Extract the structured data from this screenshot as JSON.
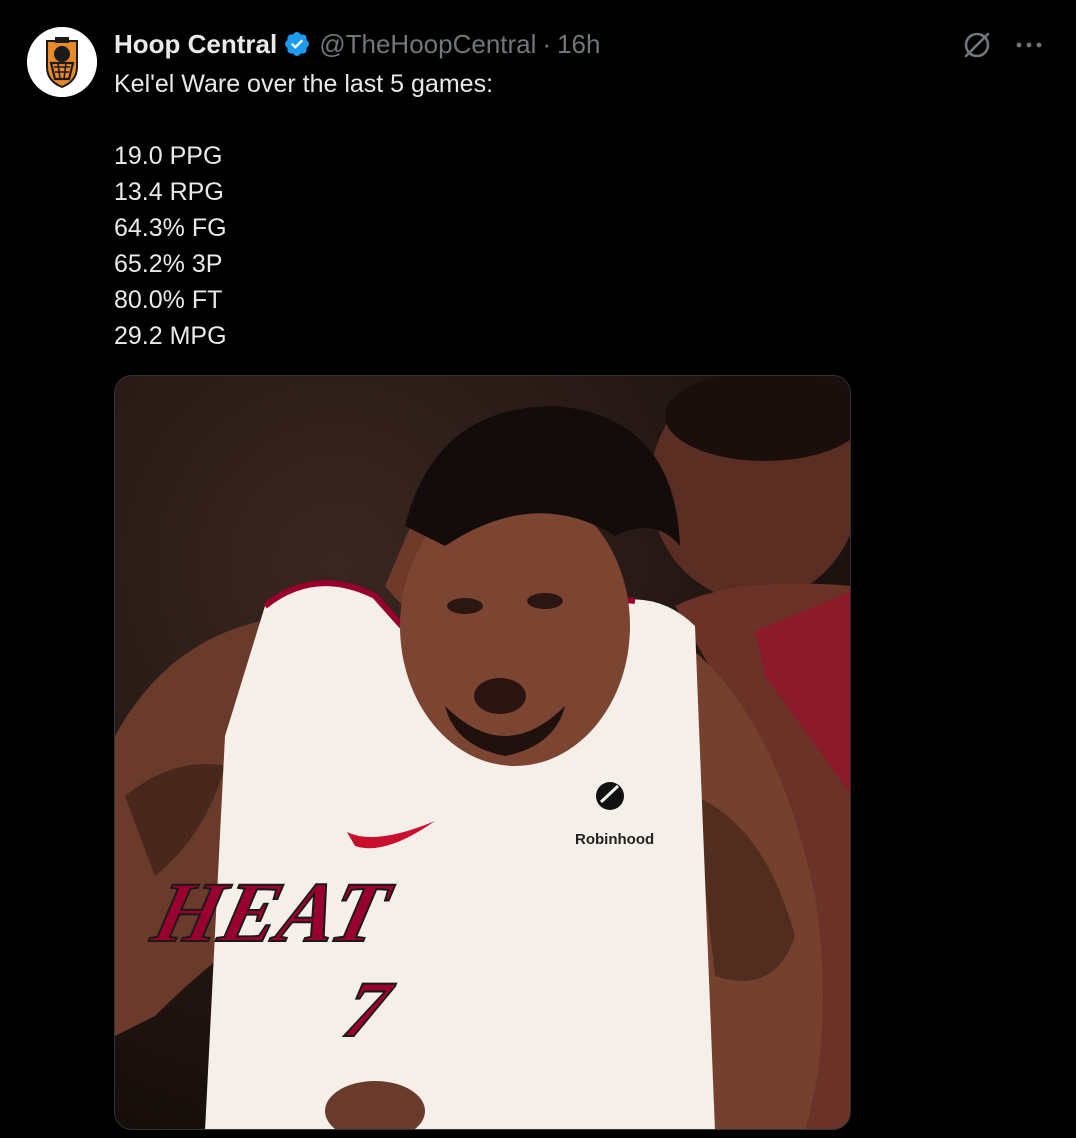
{
  "author": {
    "display_name": "Hoop Central",
    "handle": "@TheHoopCentral",
    "separator": "·",
    "timestamp": "16h",
    "verified": true,
    "avatar_icon": "hoop-central-logo"
  },
  "tweet": {
    "intro": "Kel'el Ware over the last 5 games:",
    "stats": [
      "19.0 PPG",
      "13.4 RPG",
      "64.3% FG",
      "65.2% 3P",
      "80.0% FT",
      "29.2 MPG"
    ]
  },
  "media": {
    "jersey_text": "HEAT",
    "jersey_number": "7",
    "sponsor": "Robinhood"
  },
  "icons": {
    "verified": "verified-badge-icon",
    "grok": "grok-icon",
    "more": "more-options-icon"
  },
  "colors": {
    "background": "#000000",
    "text_primary": "#e7e9ea",
    "text_secondary": "#71767b",
    "verified_blue": "#1d9bf0",
    "heat_red": "#98002e"
  }
}
